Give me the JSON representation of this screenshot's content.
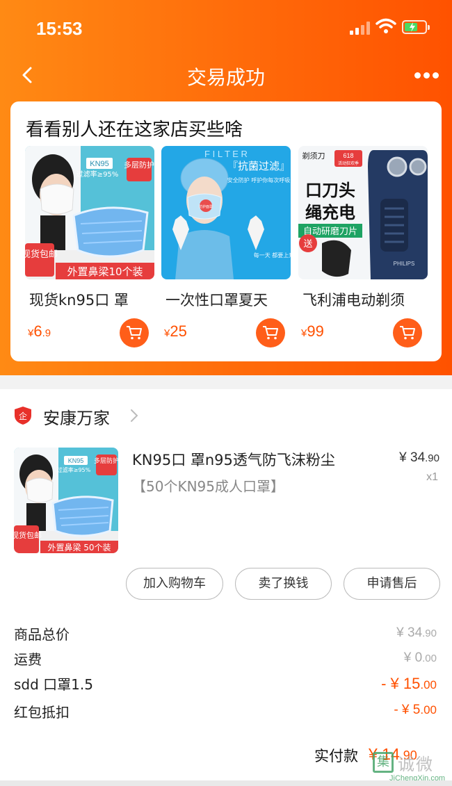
{
  "status_bar": {
    "time": "15:53"
  },
  "nav": {
    "title": "交易成功"
  },
  "recommend": {
    "title": "看看别人还在这家店买些啥",
    "items": [
      {
        "name": "现货kn95口 罩",
        "price_int": "6",
        "price_dec": ".9",
        "currency": "¥",
        "img": {
          "badge": "KN95",
          "rate": "过滤率≥95%",
          "tag": "多层防护",
          "corner": "现货包邮",
          "banner": "外置鼻梁10个装"
        }
      },
      {
        "name": "一次性口罩夏天",
        "price_int": "25",
        "price_dec": "",
        "currency": "¥",
        "img": {
          "top": "F I L T E R",
          "headline": "『抗菌过滤』",
          "sub": "安全防护 呼护你每次呼吸",
          "chip": "防护面罩",
          "side": "每一天 都要上升"
        }
      },
      {
        "name": "飞利浦电动剃须",
        "price_int": "99",
        "price_dec": "",
        "currency": "¥",
        "img": {
          "top": "剃须刀",
          "badge": "618",
          "badge_sub": "活动狂欢季",
          "line1": "口刀头",
          "line2": "绳充电",
          "line3": "自动研磨刀片",
          "bubble": "送",
          "brand": "PHILIPS"
        }
      }
    ]
  },
  "order": {
    "shop_name": "安康万家",
    "shop_logo": "企",
    "product": {
      "title": "KN95口 罩n95透气防飞沫粉尘",
      "sku": "【50个KN95成人口罩】",
      "price_int": "¥ 34",
      "price_dec": ".90",
      "qty": "x1",
      "img": {
        "badge": "KN95",
        "rate": "过滤率≥95%",
        "tag": "多层防护",
        "corner": "现货包邮",
        "banner": "外置鼻梁 50个装"
      }
    },
    "buttons": {
      "add_cart": "加入购物车",
      "resell": "卖了换钱",
      "after_sale": "申请售后"
    },
    "summary": [
      {
        "label": "商品总价",
        "int": "¥ 34",
        "dec": ".90",
        "style": "grey"
      },
      {
        "label": "运费",
        "int": "¥ 0",
        "dec": ".00",
        "style": "grey"
      },
      {
        "label": "sdd 口罩1.5",
        "int": "- ¥ 15",
        "dec": ".00",
        "style": "orange"
      },
      {
        "label": "红包抵扣",
        "int": "- ¥ 5",
        "dec": ".00",
        "style": "orange"
      }
    ],
    "pay": {
      "label": "实付款",
      "int": "¥ 14",
      "dec": ".90"
    }
  },
  "watermark": {
    "box": "集",
    "cn": "诚微信",
    "en": "JiChengXin.com"
  },
  "colors": {
    "accent": "#ff5000",
    "header_start": "#ff8a14",
    "header_end": "#ff5200",
    "cart_button": "#ff5e19"
  }
}
